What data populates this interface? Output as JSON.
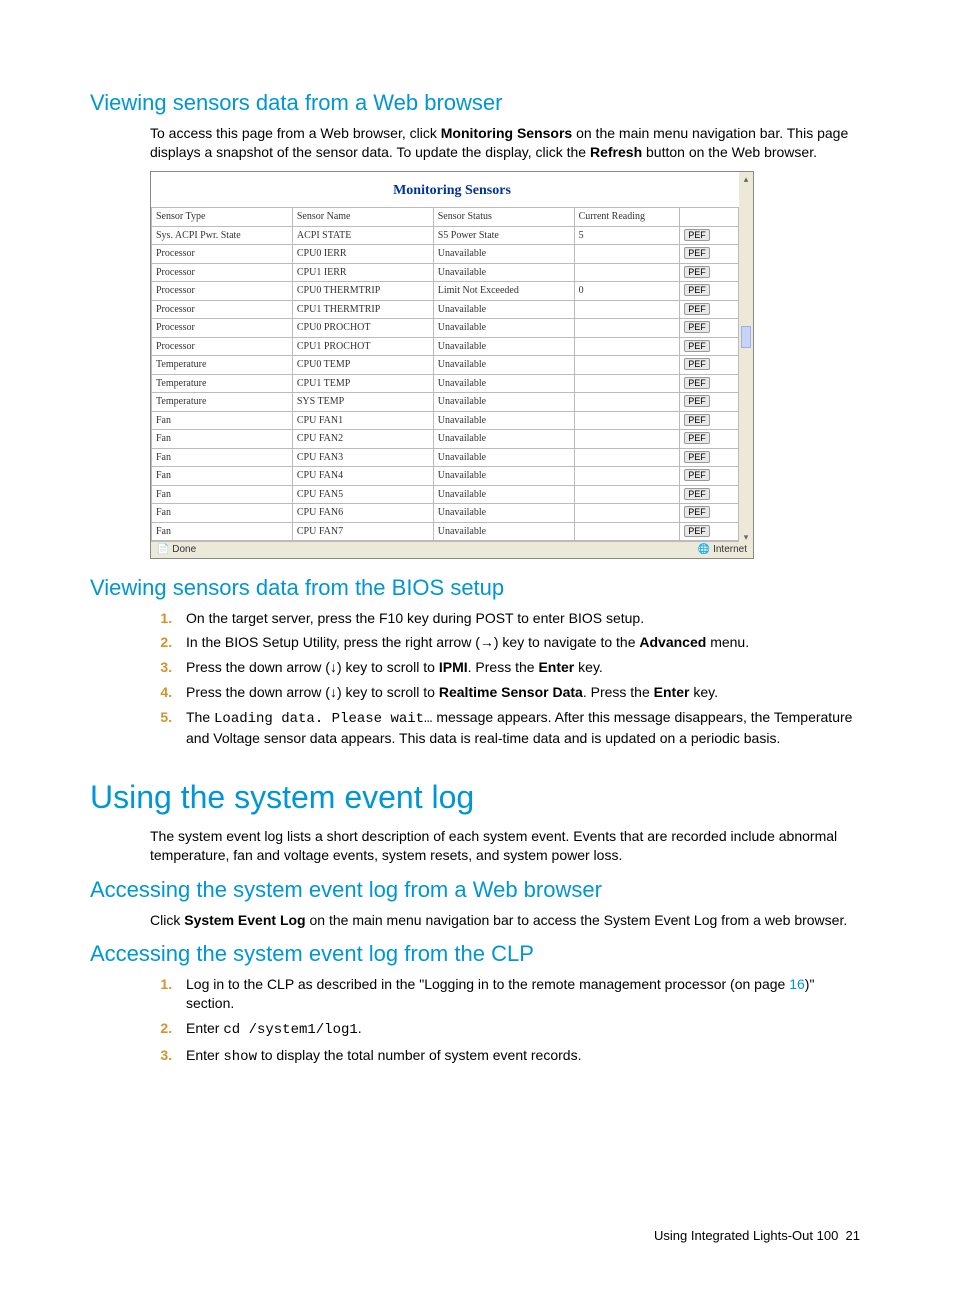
{
  "section1": {
    "heading": "Viewing sensors data from a Web browser",
    "para_prefix": "To access this page from a Web browser, click ",
    "para_bold1": "Monitoring Sensors",
    "para_mid": " on the main menu navigation bar. This page displays a snapshot of the sensor data. To update the display, click the ",
    "para_bold2": "Refresh",
    "para_suffix": " button on the Web browser."
  },
  "figure": {
    "title": "Monitoring Sensors",
    "columns": [
      "Sensor Type",
      "Sensor Name",
      "Sensor Status",
      "Current Reading",
      ""
    ],
    "pef_label": "PEF",
    "rows": [
      {
        "type": "Sys. ACPI Pwr. State",
        "name": "ACPI STATE",
        "status": "S5 Power State",
        "reading": "5"
      },
      {
        "type": "Processor",
        "name": "CPU0 IERR",
        "status": "Unavailable",
        "reading": ""
      },
      {
        "type": "Processor",
        "name": "CPU1 IERR",
        "status": "Unavailable",
        "reading": ""
      },
      {
        "type": "Processor",
        "name": "CPU0 THERMTRIP",
        "status": "Limit Not Exceeded",
        "reading": "0"
      },
      {
        "type": "Processor",
        "name": "CPU1 THERMTRIP",
        "status": "Unavailable",
        "reading": ""
      },
      {
        "type": "Processor",
        "name": "CPU0 PROCHOT",
        "status": "Unavailable",
        "reading": ""
      },
      {
        "type": "Processor",
        "name": "CPU1 PROCHOT",
        "status": "Unavailable",
        "reading": ""
      },
      {
        "type": "Temperature",
        "name": "CPU0 TEMP",
        "status": "Unavailable",
        "reading": ""
      },
      {
        "type": "Temperature",
        "name": "CPU1 TEMP",
        "status": "Unavailable",
        "reading": ""
      },
      {
        "type": "Temperature",
        "name": "SYS TEMP",
        "status": "Unavailable",
        "reading": ""
      },
      {
        "type": "Fan",
        "name": "CPU FAN1",
        "status": "Unavailable",
        "reading": ""
      },
      {
        "type": "Fan",
        "name": "CPU FAN2",
        "status": "Unavailable",
        "reading": ""
      },
      {
        "type": "Fan",
        "name": "CPU FAN3",
        "status": "Unavailable",
        "reading": ""
      },
      {
        "type": "Fan",
        "name": "CPU FAN4",
        "status": "Unavailable",
        "reading": ""
      },
      {
        "type": "Fan",
        "name": "CPU FAN5",
        "status": "Unavailable",
        "reading": ""
      },
      {
        "type": "Fan",
        "name": "CPU FAN6",
        "status": "Unavailable",
        "reading": ""
      },
      {
        "type": "Fan",
        "name": "CPU FAN7",
        "status": "Unavailable",
        "reading": ""
      }
    ],
    "status_left": "Done",
    "status_right": "Internet"
  },
  "section2": {
    "heading": "Viewing sensors data from the BIOS setup",
    "steps": {
      "s1": "On the target server, press the F10 key during POST to enter BIOS setup.",
      "s2_a": "In the BIOS Setup Utility, press the right arrow (→) key to navigate to the ",
      "s2_b": "Advanced",
      "s2_c": " menu.",
      "s3_a": "Press the down arrow (↓) key to scroll to ",
      "s3_b": "IPMI",
      "s3_c": ". Press the ",
      "s3_d": "Enter",
      "s3_e": " key.",
      "s4_a": "Press the down arrow (↓) key to scroll to ",
      "s4_b": "Realtime Sensor Data",
      "s4_c": ". Press the ",
      "s4_d": "Enter",
      "s4_e": " key.",
      "s5_a": "The ",
      "s5_code": "Loading data.  Please wait…",
      "s5_b": " message appears. After this message disappears, the Temperature and Voltage sensor data appears. This data is real-time data and is updated on a periodic basis."
    }
  },
  "section3": {
    "heading": "Using the system event log",
    "para": "The system event log lists a short description of each system event. Events that are recorded include abnormal temperature, fan and voltage events, system resets, and system power loss."
  },
  "section4": {
    "heading": "Accessing the system event log from a Web browser",
    "p_a": "Click ",
    "p_b": "System Event Log",
    "p_c": " on the main menu navigation bar to access the System Event Log from a web browser."
  },
  "section5": {
    "heading": "Accessing the system event log from the CLP",
    "steps": {
      "s1_a": "Log in to the CLP as described in the \"Logging in to the remote management processor (on page ",
      "s1_link": "16",
      "s1_b": ")\" section.",
      "s2_a": "Enter ",
      "s2_code": "cd /system1/log1",
      "s2_b": ".",
      "s3_a": "Enter ",
      "s3_code": "show",
      "s3_b": " to display the total number of system event records."
    }
  },
  "footer": {
    "text": "Using Integrated Lights-Out 100",
    "page": "21"
  }
}
